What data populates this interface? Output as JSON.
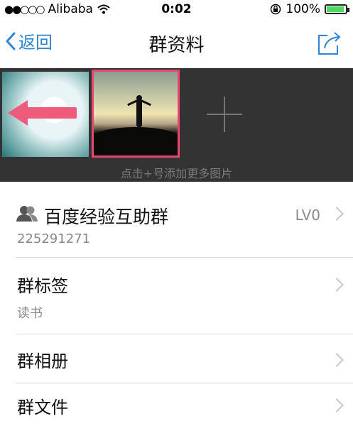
{
  "status_bar": {
    "signal_dots": "●●○○○",
    "carrier": "Alibaba",
    "time": "0:02",
    "battery_percent": "100%",
    "battery_level": 1.0,
    "battery_color": "#4cd964"
  },
  "nav": {
    "back_label": "返回",
    "title": "群资料",
    "accent_color": "#2f86d4",
    "share_icon": "share-icon"
  },
  "gallery": {
    "hint": "点击+号添加更多图片",
    "highlight_color": "#e8486f"
  },
  "group": {
    "name": "百度经验互助群",
    "id": "225291271",
    "level": "LV0"
  },
  "rows": [
    {
      "title": "群标签",
      "value": "读书"
    },
    {
      "title": "群相册"
    },
    {
      "title": "群文件"
    }
  ]
}
